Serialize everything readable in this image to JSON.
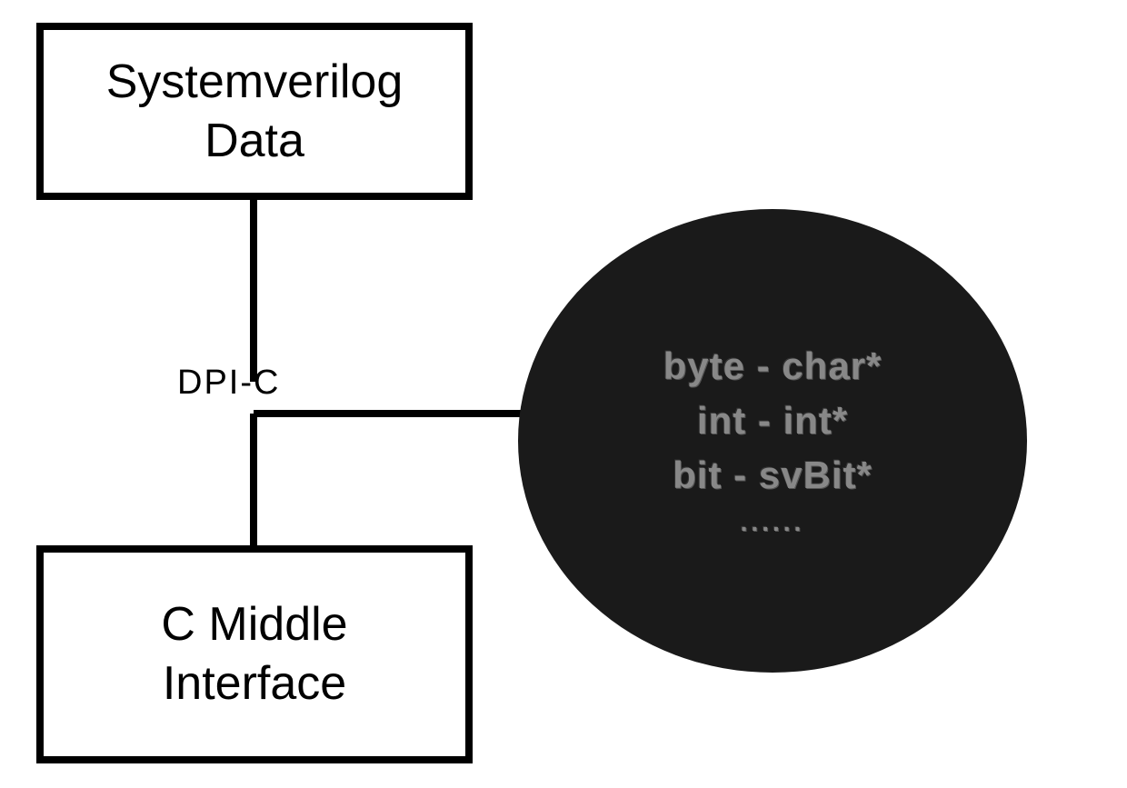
{
  "top_box": {
    "line1": "Systemverilog",
    "line2": "Data"
  },
  "bottom_box": {
    "line1": "C Middle",
    "line2": "Interface"
  },
  "connector_label": "DPI-C",
  "circle": {
    "line1": "byte - char*",
    "line2": "int - int*",
    "line3": "bit - svBit*",
    "line4": "......"
  }
}
